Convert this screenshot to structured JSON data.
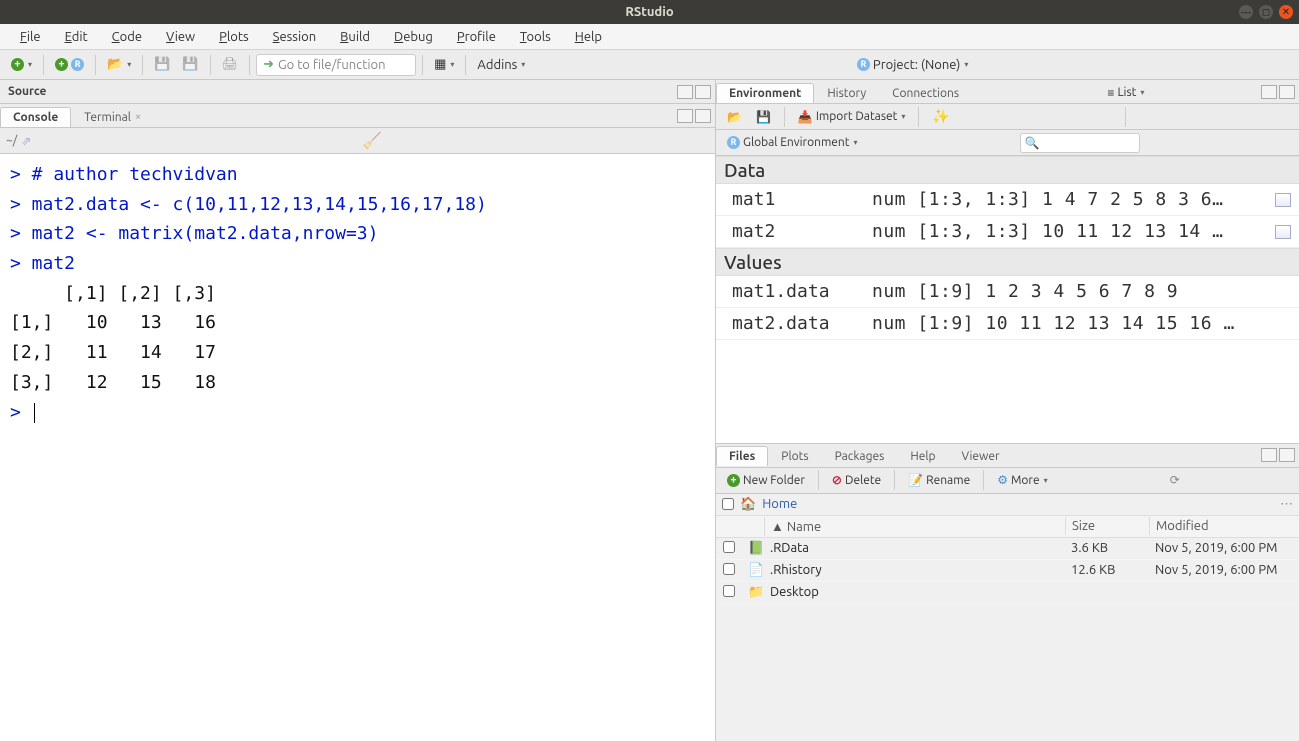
{
  "window": {
    "title": "RStudio"
  },
  "menubar": [
    "File",
    "Edit",
    "Code",
    "View",
    "Plots",
    "Session",
    "Build",
    "Debug",
    "Profile",
    "Tools",
    "Help"
  ],
  "toolbar": {
    "goto_placeholder": "Go to file/function",
    "addins": "Addins",
    "project": "Project: (None)"
  },
  "source_pane": {
    "title": "Source"
  },
  "console_pane": {
    "tabs": [
      "Console",
      "Terminal"
    ],
    "path": "~/",
    "lines": [
      {
        "type": "prompt",
        "text": "> # author techvidvan"
      },
      {
        "type": "prompt",
        "text": "> mat2.data <- c(10,11,12,13,14,15,16,17,18)"
      },
      {
        "type": "prompt",
        "text": "> mat2 <- matrix(mat2.data,nrow=3)"
      },
      {
        "type": "prompt",
        "text": "> mat2"
      },
      {
        "type": "output",
        "text": "     [,1] [,2] [,3]"
      },
      {
        "type": "output",
        "text": "[1,]   10   13   16"
      },
      {
        "type": "output",
        "text": "[2,]   11   14   17"
      },
      {
        "type": "output",
        "text": "[3,]   12   15   18"
      },
      {
        "type": "prompt",
        "text": "> "
      }
    ]
  },
  "env_pane": {
    "tabs": [
      "Environment",
      "History",
      "Connections"
    ],
    "import": "Import Dataset",
    "view_mode": "List",
    "scope": "Global Environment",
    "sections": {
      "data_label": "Data",
      "values_label": "Values"
    },
    "data_rows": [
      {
        "name": "mat1",
        "value": "num [1:3, 1:3] 1 4 7 2 5 8 3 6…",
        "grid": true
      },
      {
        "name": "mat2",
        "value": "num [1:3, 1:3] 10 11 12 13 14 …",
        "grid": true
      }
    ],
    "value_rows": [
      {
        "name": "mat1.data",
        "value": "num [1:9] 1 2 3 4 5 6 7 8 9"
      },
      {
        "name": "mat2.data",
        "value": "num [1:9] 10 11 12 13 14 15 16 …"
      }
    ]
  },
  "files_pane": {
    "tabs": [
      "Files",
      "Plots",
      "Packages",
      "Help",
      "Viewer"
    ],
    "buttons": {
      "new_folder": "New Folder",
      "delete": "Delete",
      "rename": "Rename",
      "more": "More"
    },
    "path": "Home",
    "cols": {
      "name": "Name",
      "size": "Size",
      "modified": "Modified"
    },
    "rows": [
      {
        "icon": "rdata",
        "name": ".RData",
        "size": "3.6 KB",
        "modified": "Nov 5, 2019, 6:00 PM"
      },
      {
        "icon": "rhistory",
        "name": ".Rhistory",
        "size": "12.6 KB",
        "modified": "Nov 5, 2019, 6:00 PM"
      },
      {
        "icon": "folder",
        "name": "Desktop",
        "size": "",
        "modified": ""
      }
    ]
  }
}
